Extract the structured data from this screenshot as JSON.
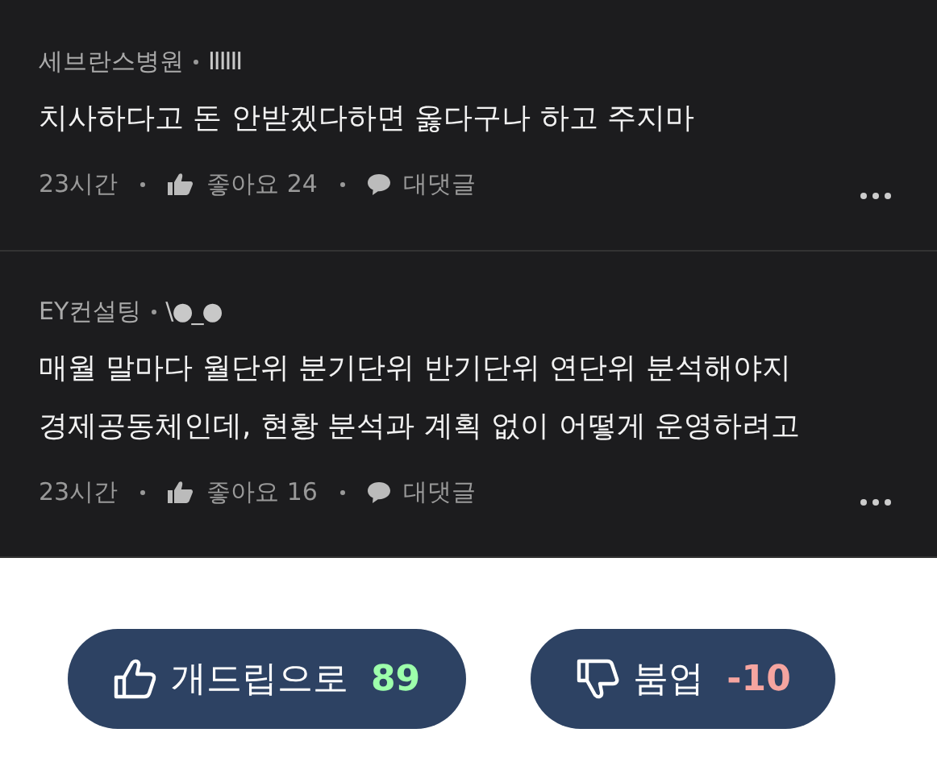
{
  "comments": [
    {
      "author": "세브란스병원",
      "nickname": "IIIIII",
      "text": [
        "치사하다고 돈 안받겠다하면 옳다구나 하고 주지마"
      ],
      "time": "23시간",
      "likes": "좋아요 24",
      "reply": "대댓글"
    },
    {
      "author": "EY컨설팅",
      "nickname": "\\●_●",
      "text": [
        "매월 말마다 월단위 분기단위 반기단위 연단위 분석해야지",
        "경제공동체인데, 현황 분석과 계획 없이 어떻게 운영하려고"
      ],
      "time": "23시간",
      "likes": "좋아요 16",
      "reply": "대댓글"
    }
  ],
  "votes": [
    {
      "kind": "up",
      "label": "개드립으로",
      "count": "89"
    },
    {
      "kind": "down",
      "label": "붐업",
      "count": "-10"
    }
  ]
}
